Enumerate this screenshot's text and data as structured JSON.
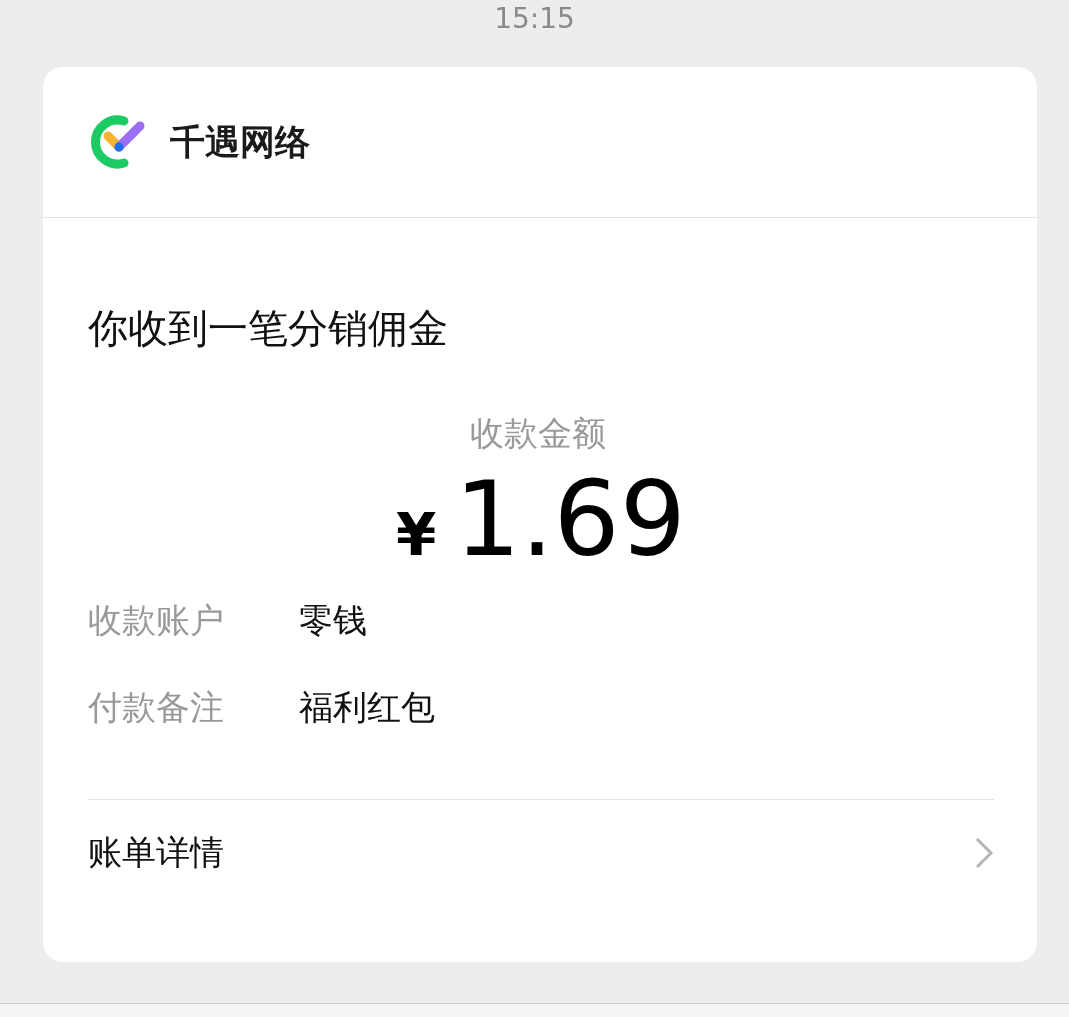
{
  "status_bar": {
    "time": "15:15"
  },
  "card": {
    "merchant": "千遇网络",
    "title": "你收到一笔分销佣金",
    "amount_label": "收款金额",
    "currency": "¥",
    "amount": "1.69",
    "details": [
      {
        "label": "收款账户",
        "value": "零钱"
      },
      {
        "label": "付款备注",
        "value": "福利红包"
      }
    ],
    "link": "账单详情"
  }
}
